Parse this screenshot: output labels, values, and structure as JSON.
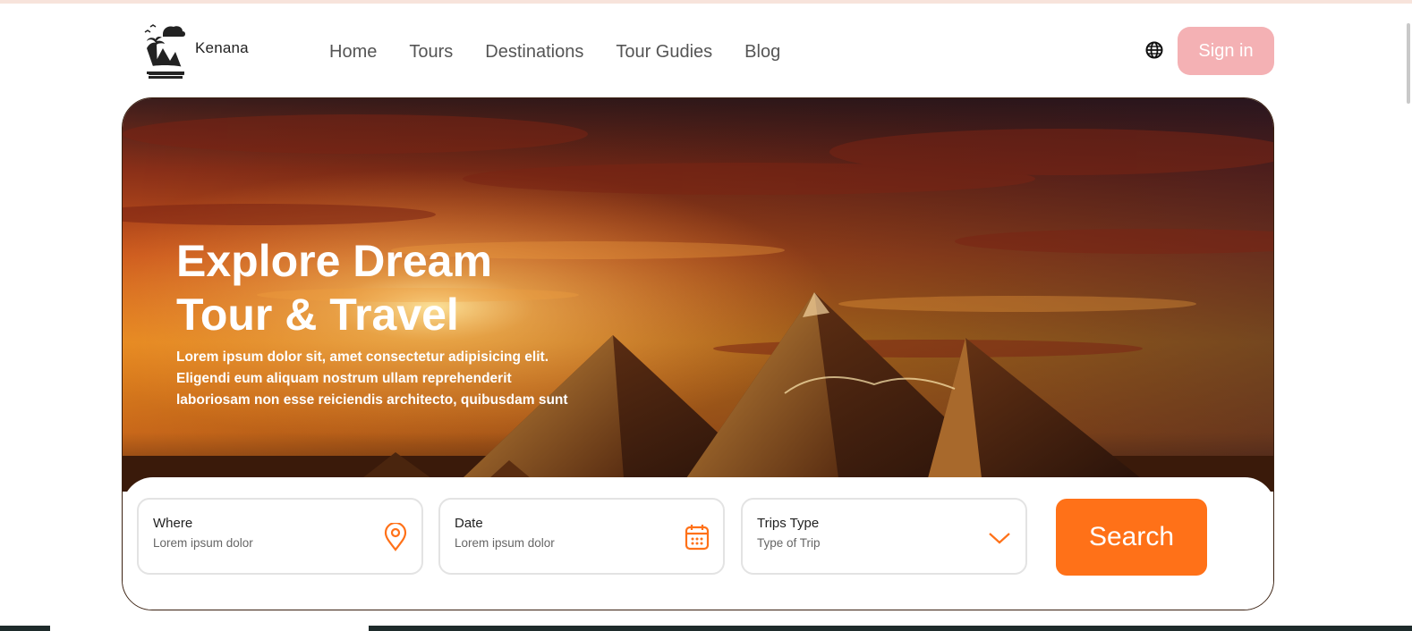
{
  "brand": {
    "name": "Kenana"
  },
  "nav": {
    "items": [
      {
        "label": "Home"
      },
      {
        "label": "Tours"
      },
      {
        "label": "Destinations"
      },
      {
        "label": "Tour Gudies"
      },
      {
        "label": "Blog"
      }
    ]
  },
  "header": {
    "language_icon": "globe-icon",
    "signin_label": "Sign in"
  },
  "hero": {
    "title": "Explore Dream\nTour & Travel",
    "description": "Lorem ipsum dolor sit, amet consectetur adipisicing elit. Eligendi eum aliquam nostrum ullam reprehenderit laboriosam non esse reiciendis architecto, quibusdam sunt"
  },
  "search": {
    "fields": [
      {
        "label": "Where",
        "placeholder": "Lorem ipsum dolor",
        "icon": "location-pin-icon"
      },
      {
        "label": "Date",
        "placeholder": "Lorem ipsum dolor",
        "icon": "calendar-icon"
      },
      {
        "label": "Trips Type",
        "placeholder": "Type of Trip",
        "icon": "chevron-down-icon"
      }
    ],
    "button_label": "Search"
  },
  "colors": {
    "accent": "#ff7118",
    "signin_bg": "#f4b1b4",
    "top_strip": "#f7e3db",
    "text_dark": "#222222"
  }
}
